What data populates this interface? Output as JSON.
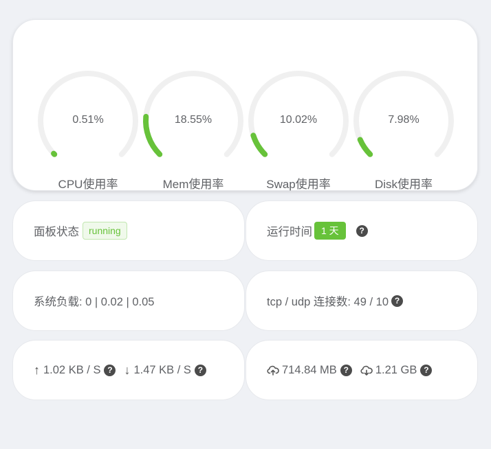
{
  "gauges": [
    {
      "value": "0.51%",
      "percent": 0.51,
      "label": "CPU使用率"
    },
    {
      "value": "18.55%",
      "percent": 18.55,
      "label": "Mem使用率"
    },
    {
      "value": "10.02%",
      "percent": 10.02,
      "label": "Swap使用率"
    },
    {
      "value": "7.98%",
      "percent": 7.98,
      "label": "Disk使用率"
    }
  ],
  "colors": {
    "accent": "#67c23a",
    "track": "#f0f0f0"
  },
  "panel_status": {
    "label": "面板状态",
    "badge": "running"
  },
  "uptime": {
    "label": "运行时间",
    "badge": "1 天",
    "help_icon": "question-circle-icon"
  },
  "load": {
    "text": "系统负载: 0 | 0.02 | 0.05"
  },
  "connections": {
    "text": "tcp / udp 连接数: 49 / 10",
    "help_icon": "question-circle-icon"
  },
  "network": {
    "up_icon": "arrow-up-icon",
    "up": "1.02 KB / S",
    "down_icon": "arrow-down-icon",
    "down": "1.47 KB / S",
    "help_icon": "question-circle-icon"
  },
  "traffic": {
    "upload_icon": "cloud-upload-icon",
    "upload": "714.84 MB",
    "download_icon": "cloud-download-icon",
    "download": "1.21 GB",
    "help_icon": "question-circle-icon"
  }
}
